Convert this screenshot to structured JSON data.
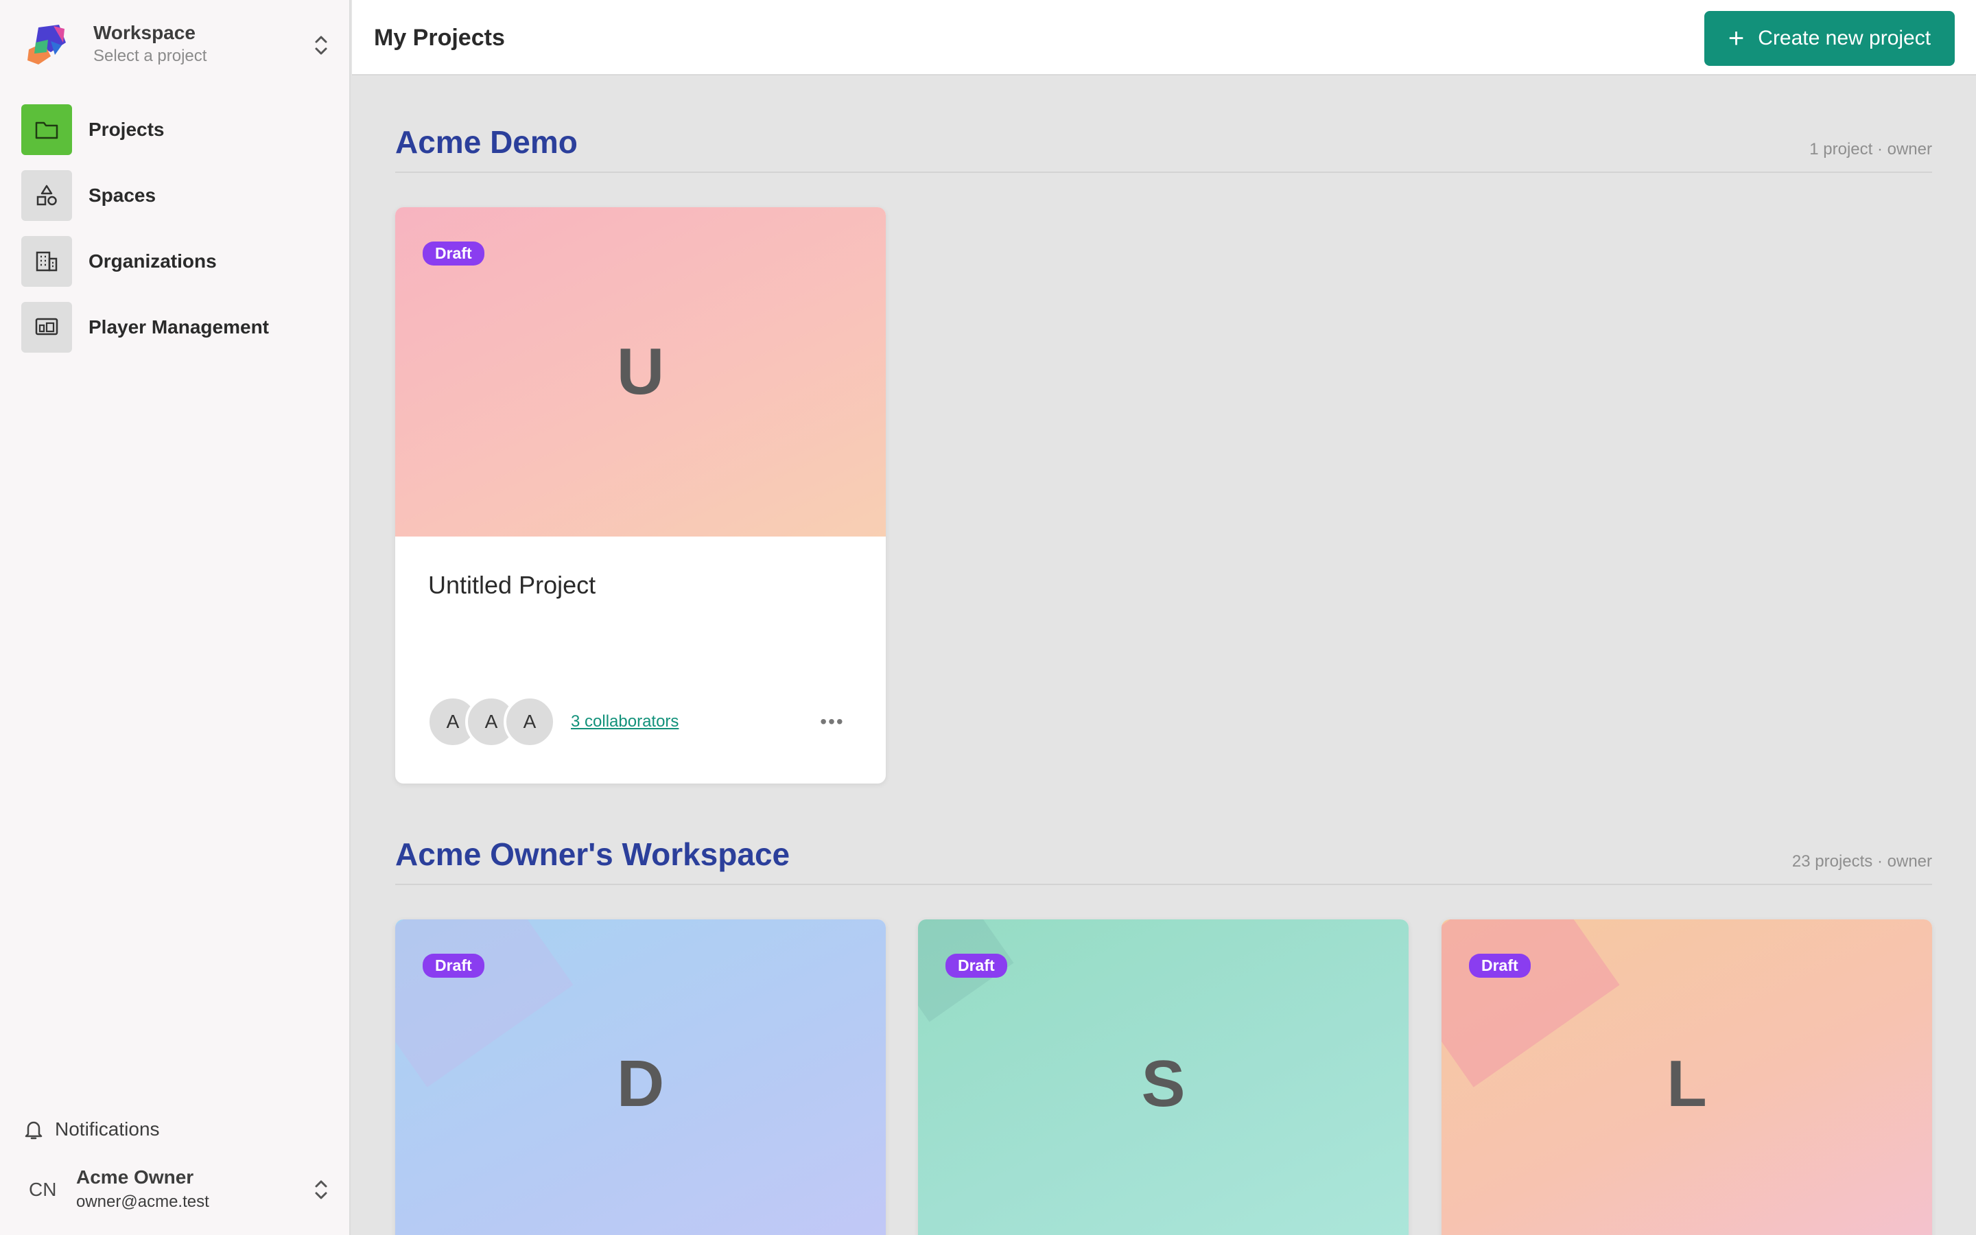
{
  "workspace": {
    "title": "Workspace",
    "subtitle": "Select a project"
  },
  "sidebar": {
    "items": [
      {
        "label": "Projects",
        "icon": "folder-icon",
        "active": true
      },
      {
        "label": "Spaces",
        "icon": "shapes-icon"
      },
      {
        "label": "Organizations",
        "icon": "building-icon"
      },
      {
        "label": "Player Management",
        "icon": "player-icon"
      }
    ],
    "notifications": {
      "label": "Notifications",
      "icon": "bell-icon"
    },
    "user": {
      "initials": "CN",
      "name": "Acme Owner",
      "email": "owner@acme.test"
    }
  },
  "header": {
    "title": "My Projects",
    "create_label": "Create new project"
  },
  "sections": [
    {
      "title": "Acme Demo",
      "meta": "1 project · owner",
      "cards": [
        {
          "badge": "Draft",
          "letter": "U",
          "title": "Untitled Project",
          "collaborators": "3 collaborators",
          "avatars": [
            "A",
            "A",
            "A"
          ]
        }
      ]
    },
    {
      "title": "Acme Owner's Workspace",
      "meta": "23 projects · owner",
      "cards": [
        {
          "badge": "Draft",
          "letter": "D"
        },
        {
          "badge": "Draft",
          "letter": "S"
        },
        {
          "badge": "Draft",
          "letter": "L"
        }
      ]
    }
  ],
  "colors": {
    "accent": "#12917a",
    "active_nav": "#5cbf3a",
    "badge": "#8a3df0",
    "section_title": "#2b3f9b"
  }
}
